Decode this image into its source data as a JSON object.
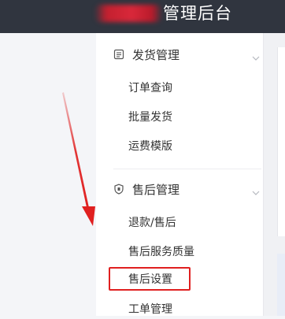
{
  "header": {
    "title": "管理后台"
  },
  "sidebar": {
    "groups": [
      {
        "title": "发货管理",
        "icon": "document-icon",
        "items": [
          "订单查询",
          "批量发货",
          "运费模版"
        ]
      },
      {
        "title": "售后管理",
        "icon": "shield-icon",
        "items": [
          "退款/售后",
          "售后服务质量",
          "售后设置",
          "工单管理"
        ]
      }
    ],
    "highlighted_item": "售后设置"
  },
  "colors": {
    "topbar": "#30353f",
    "annotation_red": "#e02020",
    "text": "#333333",
    "chevron": "#b5b8bf"
  }
}
